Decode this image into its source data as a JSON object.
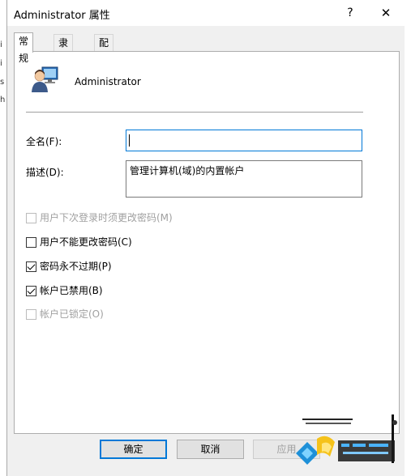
{
  "window": {
    "title": "Administrator 属性"
  },
  "titlebar": {
    "help_glyph": "?",
    "close_glyph": "✕"
  },
  "tabs": [
    {
      "label": "常规",
      "active": true
    },
    {
      "label": "隶属于",
      "active": false
    },
    {
      "label": "配置文件",
      "active": false
    }
  ],
  "general": {
    "user_name": "Administrator",
    "full_name_label": "全名(F):",
    "full_name_value": "",
    "description_label": "描述(D):",
    "description_value": "管理计算机(域)的内置帐户",
    "options": [
      {
        "label": "用户下次登录时须更改密码(M)",
        "checked": false,
        "enabled": false
      },
      {
        "label": "用户不能更改密码(C)",
        "checked": false,
        "enabled": true
      },
      {
        "label": "密码永不过期(P)",
        "checked": true,
        "enabled": true
      },
      {
        "label": "帐户已禁用(B)",
        "checked": true,
        "enabled": true
      },
      {
        "label": "帐户已锁定(O)",
        "checked": false,
        "enabled": false
      }
    ]
  },
  "buttons": {
    "ok": "确定",
    "cancel": "取消",
    "apply": "应用"
  },
  "left_strip_fragments": [
    "i",
    "i",
    "s",
    "h"
  ],
  "colors": {
    "accent": "#0078d7",
    "panel": "#ffffff",
    "dialog_bg": "#f0f0f0"
  }
}
